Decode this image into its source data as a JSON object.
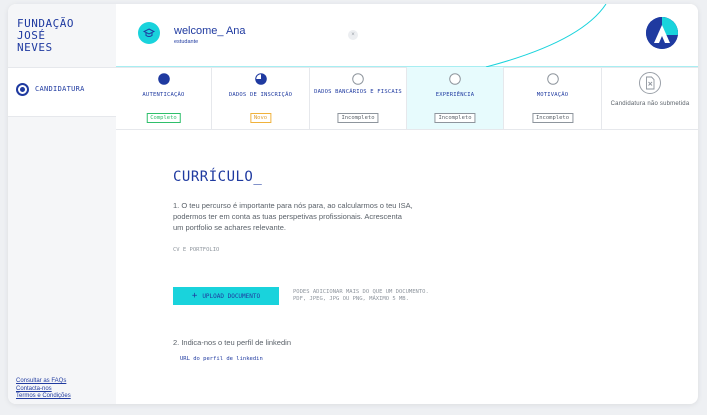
{
  "brand": {
    "lines": [
      "FUNDAÇÃO",
      "JOSÉ",
      "NEVES"
    ]
  },
  "sidebar": {
    "items": [
      {
        "label": "CANDIDATURA"
      }
    ],
    "footer_links": [
      "Consultar as FAQs",
      "Contacta-nos",
      "Termos e Condições"
    ]
  },
  "header": {
    "greeting": "welcome_ Ana",
    "role": "estudante",
    "close_symbol": "×"
  },
  "steps": [
    {
      "name": "AUTENTICAÇÃO",
      "status": "Completo",
      "state": "done"
    },
    {
      "name": "DADOS DE INSCRIÇÃO",
      "status": "Novo",
      "state": "new"
    },
    {
      "name": "DADOS BANCÁRIOS E FISCAIS",
      "status": "Incompleto",
      "state": "incomplete"
    },
    {
      "name": "EXPERIÊNCIA",
      "status": "Incompleto",
      "state": "incomplete",
      "active": true
    },
    {
      "name": "MOTIVAÇÃO",
      "status": "Incompleto",
      "state": "incomplete"
    },
    {
      "name": "Candidatura não submetida",
      "state": "final"
    }
  ],
  "main": {
    "title": "CURRÍCULO_",
    "question1": "1. O teu percurso é importante para nós para, ao calcularmos o teu ISA, podermos ter em conta as tuas perspetivas profissionais. Acrescenta um portfolio se achares relevante.",
    "cv_label": "CV E PORTFOLIO",
    "upload_label": "UPLOAD DOCUMENTO",
    "upload_hint_1": "PODES ADICIONAR MAIS DO QUE UM DOCUMENTO.",
    "upload_hint_2": "PDF, JPEG, JPG OU PNG, MÁXIMO 5 MB.",
    "question2": "2. Indica-nos o teu perfil de linkedin",
    "linkedin_placeholder": "URL do perfil de linkedin"
  },
  "colors": {
    "primary": "#1f3aa0",
    "accent": "#19d3dc",
    "complete": "#2fbf6b",
    "new": "#f0b23c",
    "active_step_bg": "#e7fbfd"
  },
  "icons": {
    "avatar": "graduation-cap-icon",
    "close": "close-icon",
    "nav": "radio-dot-icon",
    "final_step": "document-x-icon",
    "upload": "plus-icon"
  }
}
